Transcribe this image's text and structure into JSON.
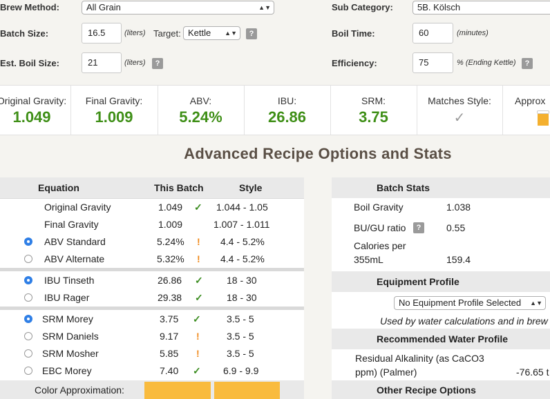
{
  "form": {
    "brew_method_label": "Brew Method:",
    "brew_method_value": "All Grain",
    "batch_size_label": "Batch Size:",
    "batch_size_value": "16.5",
    "batch_size_unit": "(liters)",
    "target_label": "Target:",
    "target_value": "Kettle",
    "est_boil_label": "Est. Boil Size:",
    "est_boil_value": "21",
    "est_boil_unit": "(liters)",
    "sub_category_label": "Sub Category:",
    "sub_category_value": "5B. Kölsch",
    "boil_time_label": "Boil Time:",
    "boil_time_value": "60",
    "boil_time_unit": "(minutes)",
    "efficiency_label": "Efficiency:",
    "efficiency_value": "75",
    "efficiency_unit": "% (Ending Kettle)",
    "help_glyph": "?"
  },
  "stats": {
    "og_label": "Original Gravity:",
    "og_value": "1.049",
    "fg_label": "Final Gravity:",
    "fg_value": "1.009",
    "abv_label": "ABV:",
    "abv_value": "5.24%",
    "ibu_label": "IBU:",
    "ibu_value": "26.86",
    "srm_label": "SRM:",
    "srm_value": "3.75",
    "matches_label": "Matches Style:",
    "approx_label": "Approx",
    "value_color": "#3f8f17"
  },
  "section_title": "Advanced Recipe Options and Stats",
  "equations": {
    "headers": {
      "equation": "Equation",
      "batch": "This Batch",
      "style": "Style"
    },
    "rows": [
      {
        "name": "Original Gravity",
        "batch": "1.049",
        "status": "✓",
        "style": "1.044 - 1.05"
      },
      {
        "name": "Final Gravity",
        "batch": "1.009",
        "status": "",
        "style": "1.007 - 1.011"
      },
      {
        "name": "ABV Standard",
        "batch": "5.24%",
        "status": "!",
        "style": "4.4 - 5.2%"
      },
      {
        "name": "ABV Alternate",
        "batch": "5.32%",
        "status": "!",
        "style": "4.4 - 5.2%"
      },
      {
        "name": "IBU Tinseth",
        "batch": "26.86",
        "status": "✓",
        "style": "18 - 30"
      },
      {
        "name": "IBU Rager",
        "batch": "29.38",
        "status": "✓",
        "style": "18 - 30"
      },
      {
        "name": "SRM Morey",
        "batch": "3.75",
        "status": "✓",
        "style": "3.5 - 5"
      },
      {
        "name": "SRM Daniels",
        "batch": "9.17",
        "status": "!",
        "style": "3.5 - 5"
      },
      {
        "name": "SRM Mosher",
        "batch": "5.85",
        "status": "!",
        "style": "3.5 - 5"
      },
      {
        "name": "EBC Morey",
        "batch": "7.40",
        "status": "✓",
        "style": "6.9 - 9.9"
      }
    ],
    "color_approx_label": "Color Approximation:",
    "color_swatch": "#f9bb3e"
  },
  "batch_stats": {
    "header": "Batch Stats",
    "boil_gravity_label": "Boil Gravity",
    "boil_gravity_value": "1.038",
    "bugu_label": "BU/GU ratio",
    "bugu_value": "0.55",
    "calories_label_1": "Calories per",
    "calories_label_2": "355mL",
    "calories_value": "159.4"
  },
  "equipment": {
    "header": "Equipment Profile",
    "select_value": "No Equipment Profile Selected",
    "note": "Used by water calculations and in brew p"
  },
  "water": {
    "header": "Recommended Water Profile",
    "residual_label_1": "Residual Alkalinity (as CaCO3",
    "residual_label_2": "ppm) (Palmer)",
    "residual_value": "-76.65 t"
  },
  "other_header": "Other Recipe Options"
}
